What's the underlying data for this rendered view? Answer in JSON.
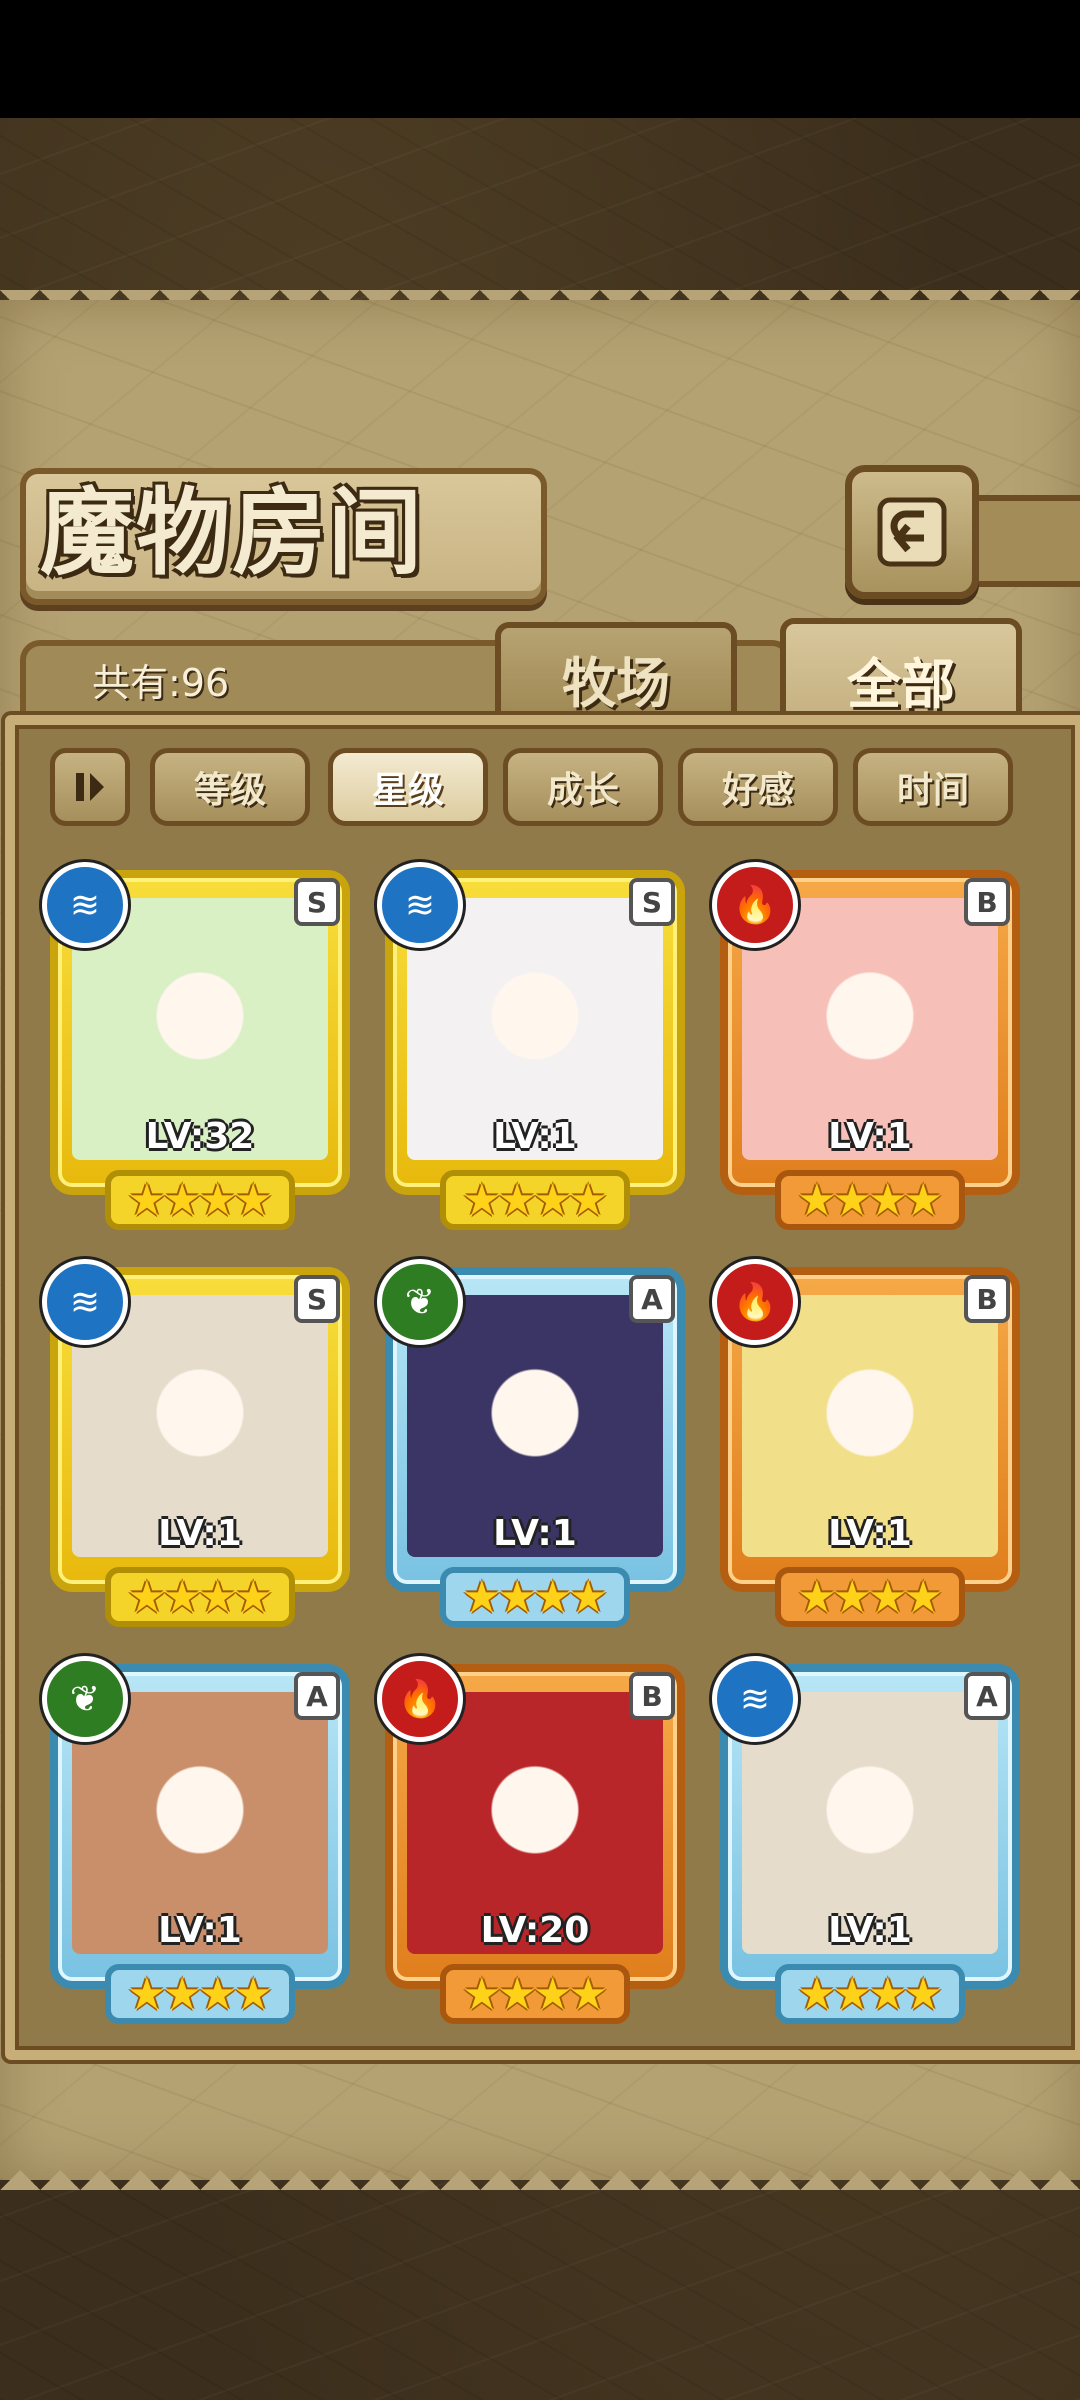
{
  "header": {
    "title": "魔物房间"
  },
  "summary": {
    "count_label": "共有:96"
  },
  "tabs": [
    {
      "label": "牧场",
      "active": false
    },
    {
      "label": "全部",
      "active": true
    }
  ],
  "sort": {
    "options": [
      {
        "label": "等级",
        "active": false
      },
      {
        "label": "星级",
        "active": true
      },
      {
        "label": "成长",
        "active": false
      },
      {
        "label": "好感",
        "active": false
      },
      {
        "label": "时间",
        "active": false
      }
    ]
  },
  "monsters": [
    {
      "rank": "S",
      "element": "water",
      "level": "LV:32",
      "stars": 4,
      "portrait_color": "#d9efc4"
    },
    {
      "rank": "S",
      "element": "water",
      "level": "LV:1",
      "stars": 4,
      "portrait_color": "#f4f1f3"
    },
    {
      "rank": "B",
      "element": "fire",
      "level": "LV:1",
      "stars": 4,
      "portrait_color": "#f6c0b8"
    },
    {
      "rank": "S",
      "element": "water",
      "level": "LV:1",
      "stars": 4,
      "portrait_color": "#e6dccb"
    },
    {
      "rank": "A",
      "element": "wood",
      "level": "LV:1",
      "stars": 4,
      "portrait_color": "#3a3565"
    },
    {
      "rank": "B",
      "element": "fire",
      "level": "LV:1",
      "stars": 4,
      "portrait_color": "#f2df8a"
    },
    {
      "rank": "A",
      "element": "wood",
      "level": "LV:1",
      "stars": 4,
      "portrait_color": "#c98f6a"
    },
    {
      "rank": "B",
      "element": "fire",
      "level": "LV:20",
      "stars": 4,
      "portrait_color": "#b8262a"
    },
    {
      "rank": "A",
      "element": "water",
      "level": "LV:1",
      "stars": 4,
      "portrait_color": "#e6dccb"
    }
  ],
  "icons": {
    "water": "water-element-icon",
    "fire": "fire-element-icon",
    "wood": "wood-element-icon",
    "back": "back-arrow-icon",
    "sort_toggle": "sort-order-icon"
  }
}
